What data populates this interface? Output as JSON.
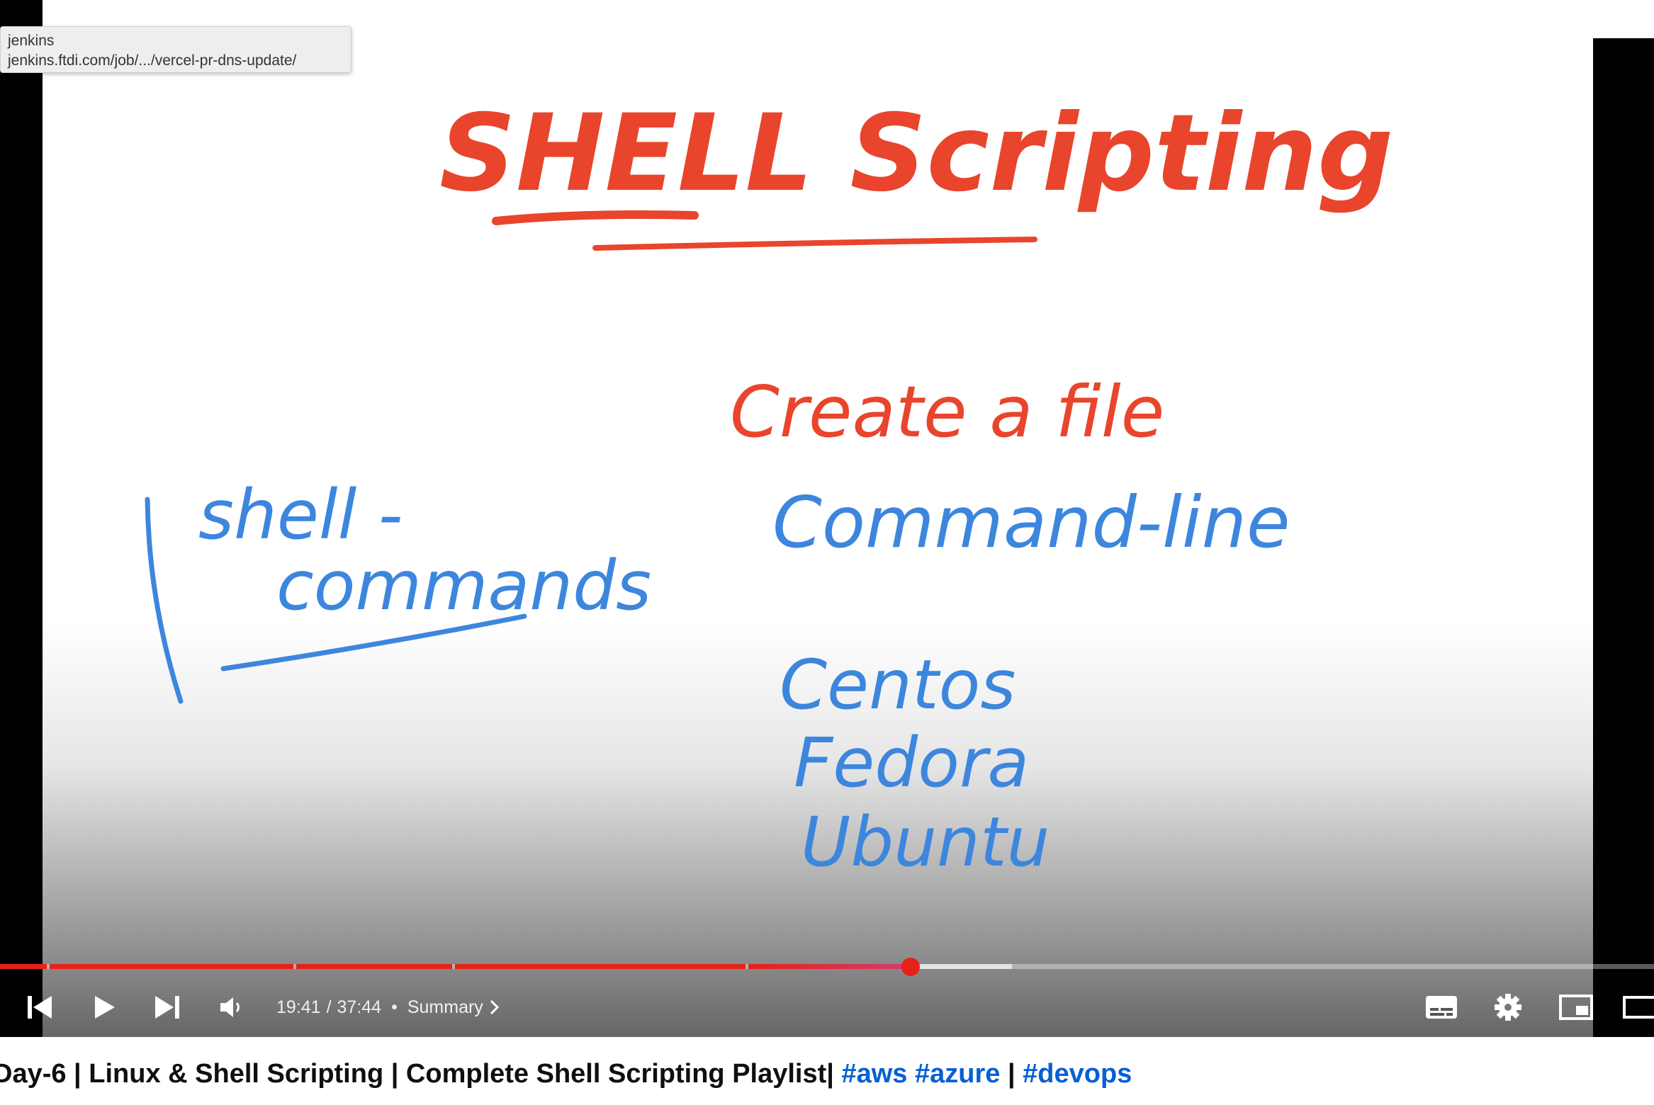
{
  "tooltip": {
    "title": "jenkins",
    "url": "jenkins.ftdi.com/job/.../vercel-pr-dns-update/"
  },
  "whiteboard": {
    "heading": "SHELL Scripting",
    "line_create": "Create a file",
    "line_shell": "shell -",
    "line_commands": "commands",
    "line_cmdline": "Command-line",
    "distros": [
      "Centos",
      "Fedora",
      "Ubuntu"
    ]
  },
  "player": {
    "current_time": "19:41",
    "duration": "37:44",
    "time_separator": "/",
    "dot": "•",
    "chapter_label": "Summary",
    "progress": 0.52,
    "icons": {
      "previous": "skip-previous-icon",
      "play": "play-icon",
      "next": "skip-next-icon",
      "volume": "volume-icon",
      "subtitles": "subtitles-icon",
      "settings": "gear-icon",
      "miniplayer": "miniplayer-icon",
      "theater": "theater-mode-icon"
    },
    "accent_color": "#e62117"
  },
  "title": {
    "text_main": "Day-6 | Linux & Shell Scripting | Complete Shell Scripting Playlist|",
    "tag_aws": "#aws",
    "tag_azure": "#azure",
    "pipe": "|",
    "tag_devops": "#devops"
  }
}
